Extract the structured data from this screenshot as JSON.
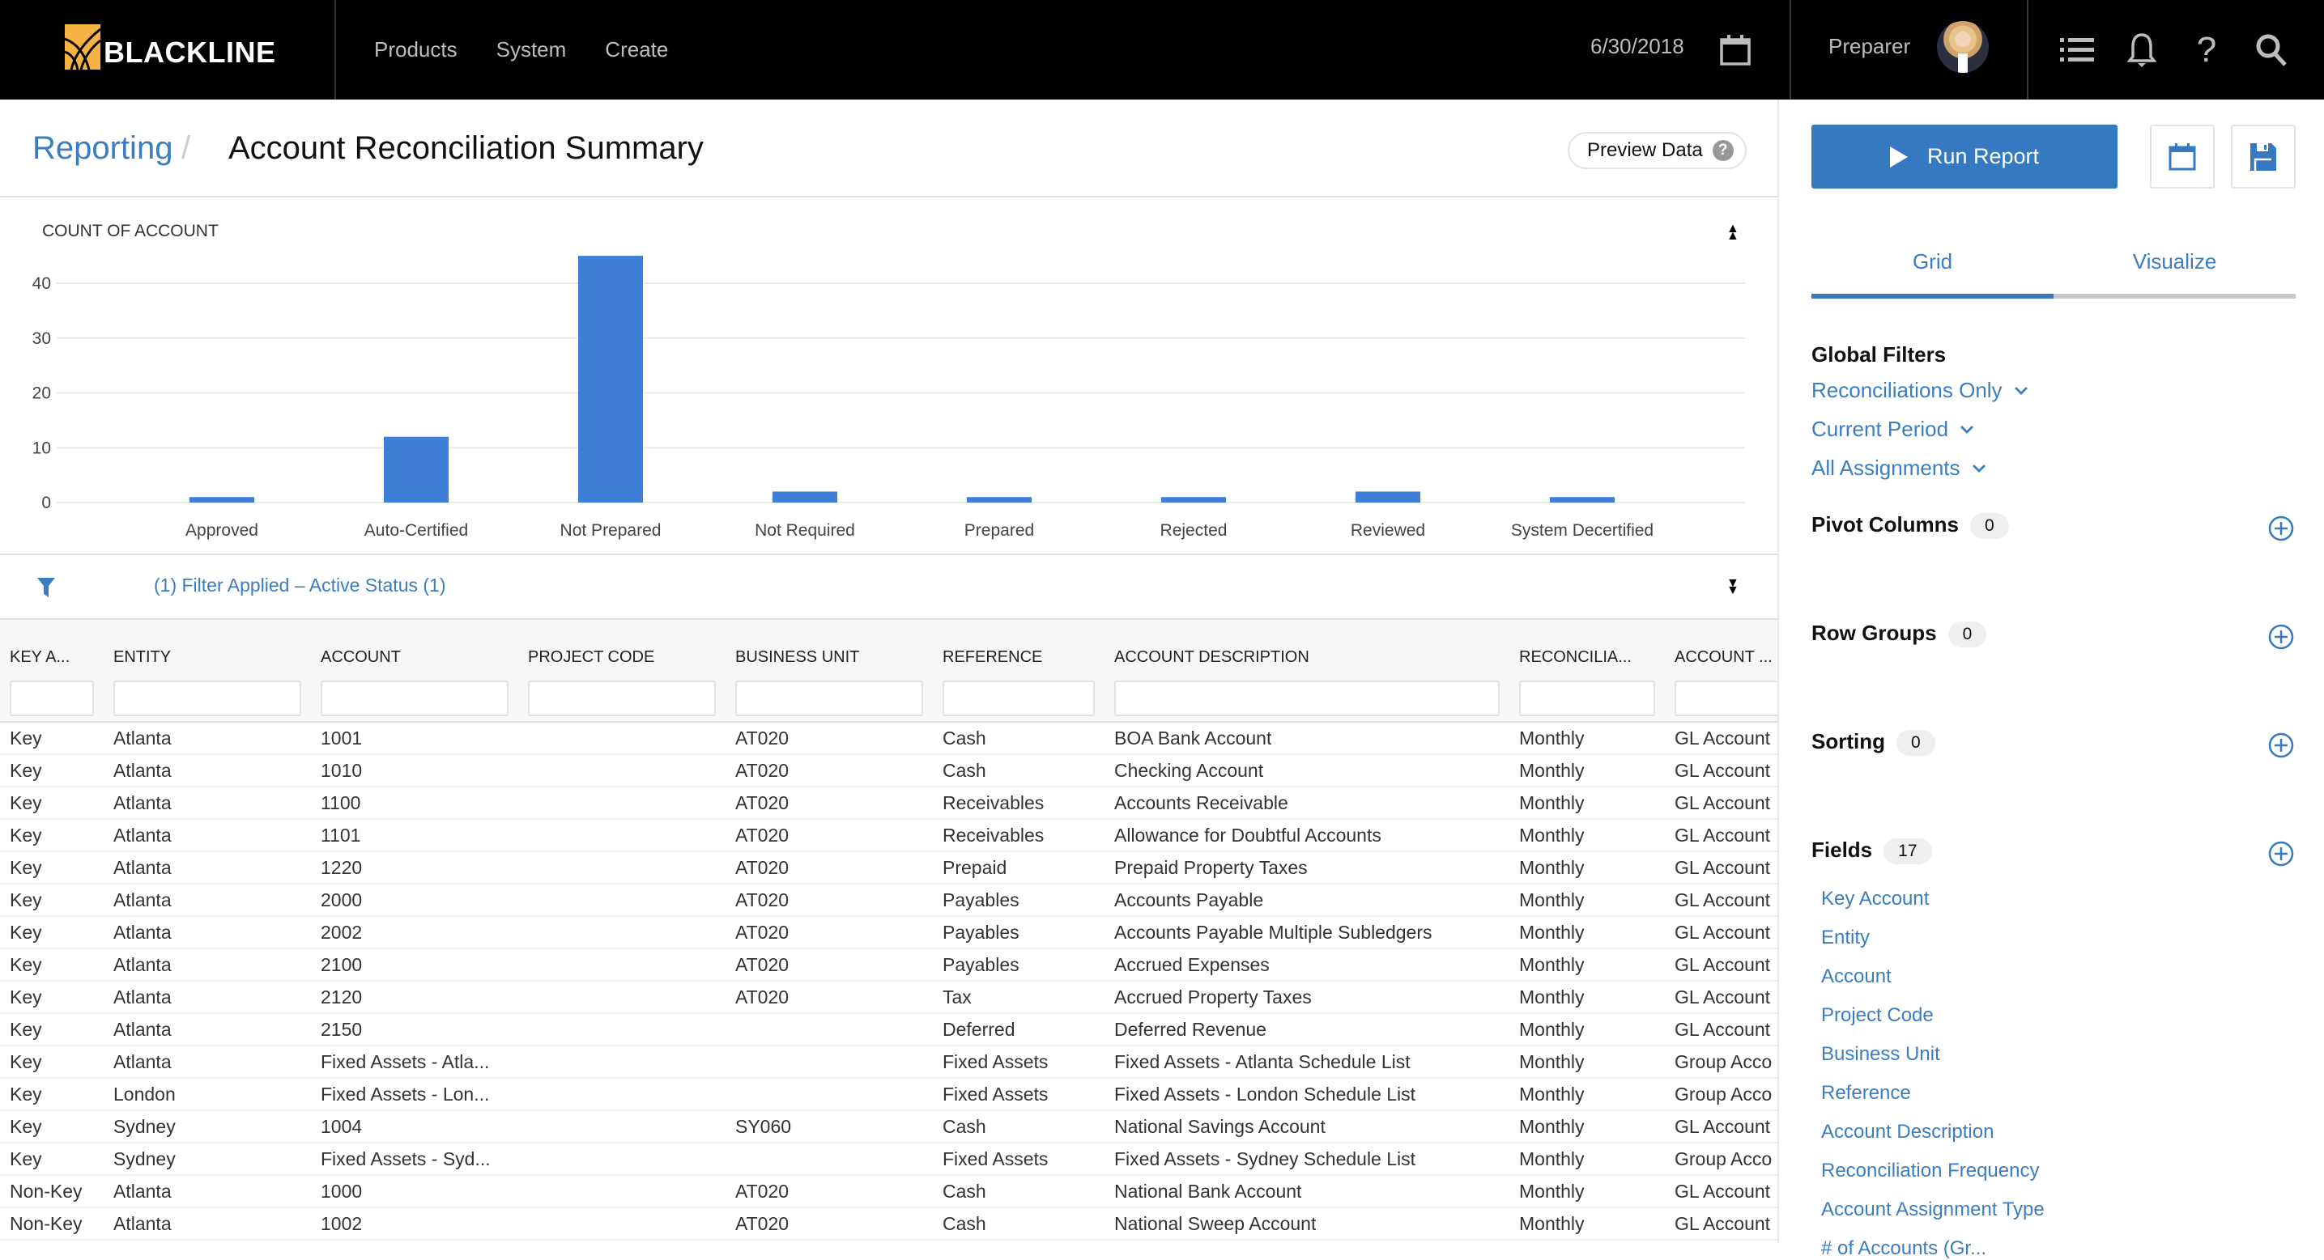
{
  "brand": {
    "name": "BLACKLINE",
    "logo_color": "#F5B343"
  },
  "nav": {
    "items": [
      "Products",
      "System",
      "Create"
    ]
  },
  "header": {
    "date": "6/30/2018",
    "user_role": "Preparer"
  },
  "breadcrumb": {
    "parent": "Reporting",
    "separator": "/",
    "current": "Account Reconciliation Summary"
  },
  "preview": {
    "label": "Preview Data",
    "help": "?"
  },
  "chart_data": {
    "type": "bar",
    "title": "COUNT OF ACCOUNT",
    "categories": [
      "Approved",
      "Auto-Certified",
      "Not Prepared",
      "Not Required",
      "Prepared",
      "Rejected",
      "Reviewed",
      "System Decertified"
    ],
    "values": [
      1,
      12,
      45,
      2,
      1,
      1,
      2,
      1
    ],
    "yticks": [
      0,
      10,
      20,
      30,
      40
    ],
    "ylim": [
      0,
      45
    ],
    "xlabel": "",
    "ylabel": "",
    "grid": true,
    "color": "#3F7FD8"
  },
  "filter": {
    "text": "(1) Filter Applied – Active Status (1)"
  },
  "grid": {
    "columns": [
      "KEY A...",
      "ENTITY",
      "ACCOUNT",
      "PROJECT CODE",
      "BUSINESS UNIT",
      "REFERENCE",
      "ACCOUNT DESCRIPTION",
      "RECONCILIA...",
      "ACCOUNT ..."
    ],
    "rows": [
      [
        "Key",
        "Atlanta",
        "1001",
        "",
        "AT020",
        "Cash",
        "BOA Bank Account",
        "Monthly",
        "GL Account"
      ],
      [
        "Key",
        "Atlanta",
        "1010",
        "",
        "AT020",
        "Cash",
        "Checking Account",
        "Monthly",
        "GL Account"
      ],
      [
        "Key",
        "Atlanta",
        "1100",
        "",
        "AT020",
        "Receivables",
        "Accounts Receivable",
        "Monthly",
        "GL Account"
      ],
      [
        "Key",
        "Atlanta",
        "1101",
        "",
        "AT020",
        "Receivables",
        "Allowance for Doubtful Accounts",
        "Monthly",
        "GL Account"
      ],
      [
        "Key",
        "Atlanta",
        "1220",
        "",
        "AT020",
        "Prepaid",
        "Prepaid Property Taxes",
        "Monthly",
        "GL Account"
      ],
      [
        "Key",
        "Atlanta",
        "2000",
        "",
        "AT020",
        "Payables",
        "Accounts Payable",
        "Monthly",
        "GL Account"
      ],
      [
        "Key",
        "Atlanta",
        "2002",
        "",
        "AT020",
        "Payables",
        "Accounts Payable Multiple Subledgers",
        "Monthly",
        "GL Account"
      ],
      [
        "Key",
        "Atlanta",
        "2100",
        "",
        "AT020",
        "Payables",
        "Accrued Expenses",
        "Monthly",
        "GL Account"
      ],
      [
        "Key",
        "Atlanta",
        "2120",
        "",
        "AT020",
        "Tax",
        "Accrued Property Taxes",
        "Monthly",
        "GL Account"
      ],
      [
        "Key",
        "Atlanta",
        "2150",
        "",
        "",
        "Deferred",
        "Deferred Revenue",
        "Monthly",
        "GL Account"
      ],
      [
        "Key",
        "Atlanta",
        "Fixed Assets - Atla...",
        "",
        "",
        "Fixed Assets",
        "Fixed Assets - Atlanta Schedule List",
        "Monthly",
        "Group Acco"
      ],
      [
        "Key",
        "London",
        "Fixed Assets - Lon...",
        "",
        "",
        "Fixed Assets",
        "Fixed Assets - London Schedule List",
        "Monthly",
        "Group Acco"
      ],
      [
        "Key",
        "Sydney",
        "1004",
        "",
        "SY060",
        "Cash",
        "National Savings Account",
        "Monthly",
        "GL Account"
      ],
      [
        "Key",
        "Sydney",
        "Fixed Assets - Syd...",
        "",
        "",
        "Fixed Assets",
        "Fixed Assets - Sydney Schedule List",
        "Monthly",
        "Group Acco"
      ],
      [
        "Non-Key",
        "Atlanta",
        "1000",
        "",
        "AT020",
        "Cash",
        "National Bank Account",
        "Monthly",
        "GL Account"
      ],
      [
        "Non-Key",
        "Atlanta",
        "1002",
        "",
        "AT020",
        "Cash",
        "National Sweep Account",
        "Monthly",
        "GL Account"
      ]
    ]
  },
  "panel": {
    "run_label": "Run Report",
    "tabs": [
      "Grid",
      "Visualize"
    ],
    "active_tab": "Grid",
    "global_filters_title": "Global Filters",
    "global_filters": [
      "Reconciliations Only",
      "Current Period",
      "All Assignments"
    ],
    "sections": [
      {
        "title": "Pivot Columns",
        "count": "0"
      },
      {
        "title": "Row Groups",
        "count": "0"
      },
      {
        "title": "Sorting",
        "count": "0"
      },
      {
        "title": "Fields",
        "count": "17"
      }
    ],
    "fields": [
      "Key Account",
      "Entity",
      "Account",
      "Project Code",
      "Business Unit",
      "Reference",
      "Account Description",
      "Reconciliation Frequency",
      "Account Assignment Type",
      "# of Accounts (Gr..."
    ],
    "accent": "#3579C0"
  }
}
